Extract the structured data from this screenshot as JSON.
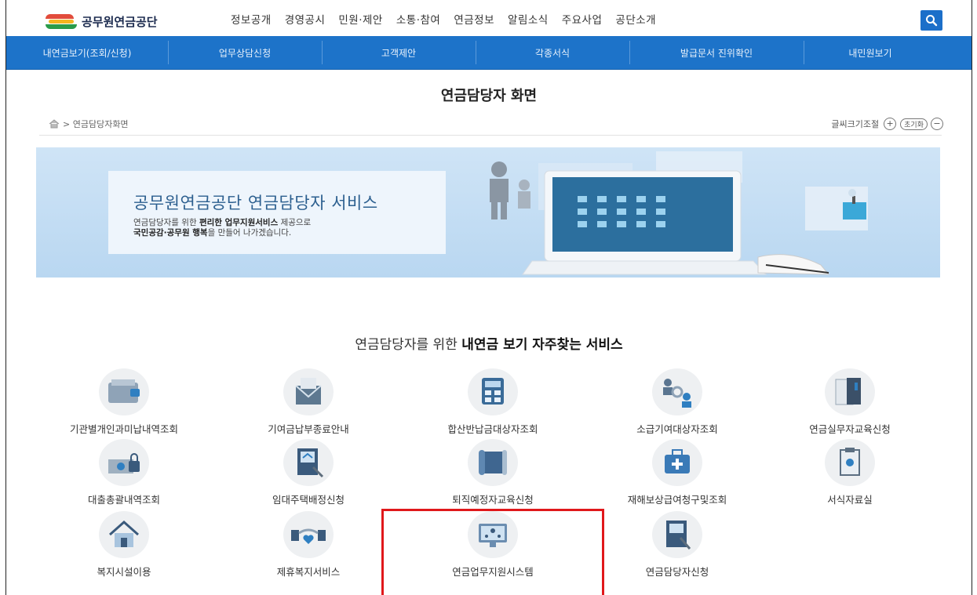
{
  "header": {
    "logo_text": "공무원연금공단",
    "gnb": [
      "정보공개",
      "경영공시",
      "민원·제안",
      "소통·참여",
      "연금정보",
      "알림소식",
      "주요사업",
      "공단소개"
    ],
    "search_icon": "search-icon"
  },
  "subnav": [
    "내연금보기(조회/신청)",
    "업무상담신청",
    "고객제안",
    "각종서식",
    "발급문서 진위확인",
    "내민원보기"
  ],
  "page": {
    "title": "연금담당자 화면",
    "breadcrumb": "> 연금담당자화면",
    "font_control_label": "글씨크기조절",
    "font_plus": "+",
    "font_reset": "초기화",
    "font_minus": "−"
  },
  "banner": {
    "title": "공무원연금공단 연금담당자 서비스",
    "line1_pre": "연금담당자를 위한 ",
    "line1_bold": "편리한 업무지원서비스",
    "line1_post": " 제공으로",
    "line2_bold": "국민공감·공무원 행복",
    "line2_post": "을 만들어 나가겠습니다."
  },
  "services": {
    "heading_pre": "연금담당자를 위한 ",
    "heading_bold": "내연금 보기 자주찾는 서비스",
    "items": [
      {
        "label": "기관별개인과미납내역조회",
        "icon": "wallet-icon"
      },
      {
        "label": "기여금납부종료안내",
        "icon": "envelope-icon"
      },
      {
        "label": "합산반납금대상자조회",
        "icon": "calculator-icon"
      },
      {
        "label": "소급기여대상자조회",
        "icon": "people-gear-icon"
      },
      {
        "label": "연금실무자교육신청",
        "icon": "notebook-icon"
      },
      {
        "label": "대출총괄내역조회",
        "icon": "money-lock-icon"
      },
      {
        "label": "임대주택배정신청",
        "icon": "house-document-icon"
      },
      {
        "label": "퇴직예정자교육신청",
        "icon": "scroll-icon"
      },
      {
        "label": "재해보상급여청구및조회",
        "icon": "medical-kit-icon"
      },
      {
        "label": "서식자료실",
        "icon": "clipboard-icon"
      },
      {
        "label": "복지시설이용",
        "icon": "house-icon"
      },
      {
        "label": "제휴복지서비스",
        "icon": "handshake-heart-icon"
      },
      {
        "label": "연금업무지원시스템",
        "icon": "monitor-network-icon"
      },
      {
        "label": "연금담당자신청",
        "icon": "document-pen-icon"
      }
    ]
  },
  "colors": {
    "brand_blue": "#1d73c9",
    "highlight_red": "#e0181b"
  }
}
